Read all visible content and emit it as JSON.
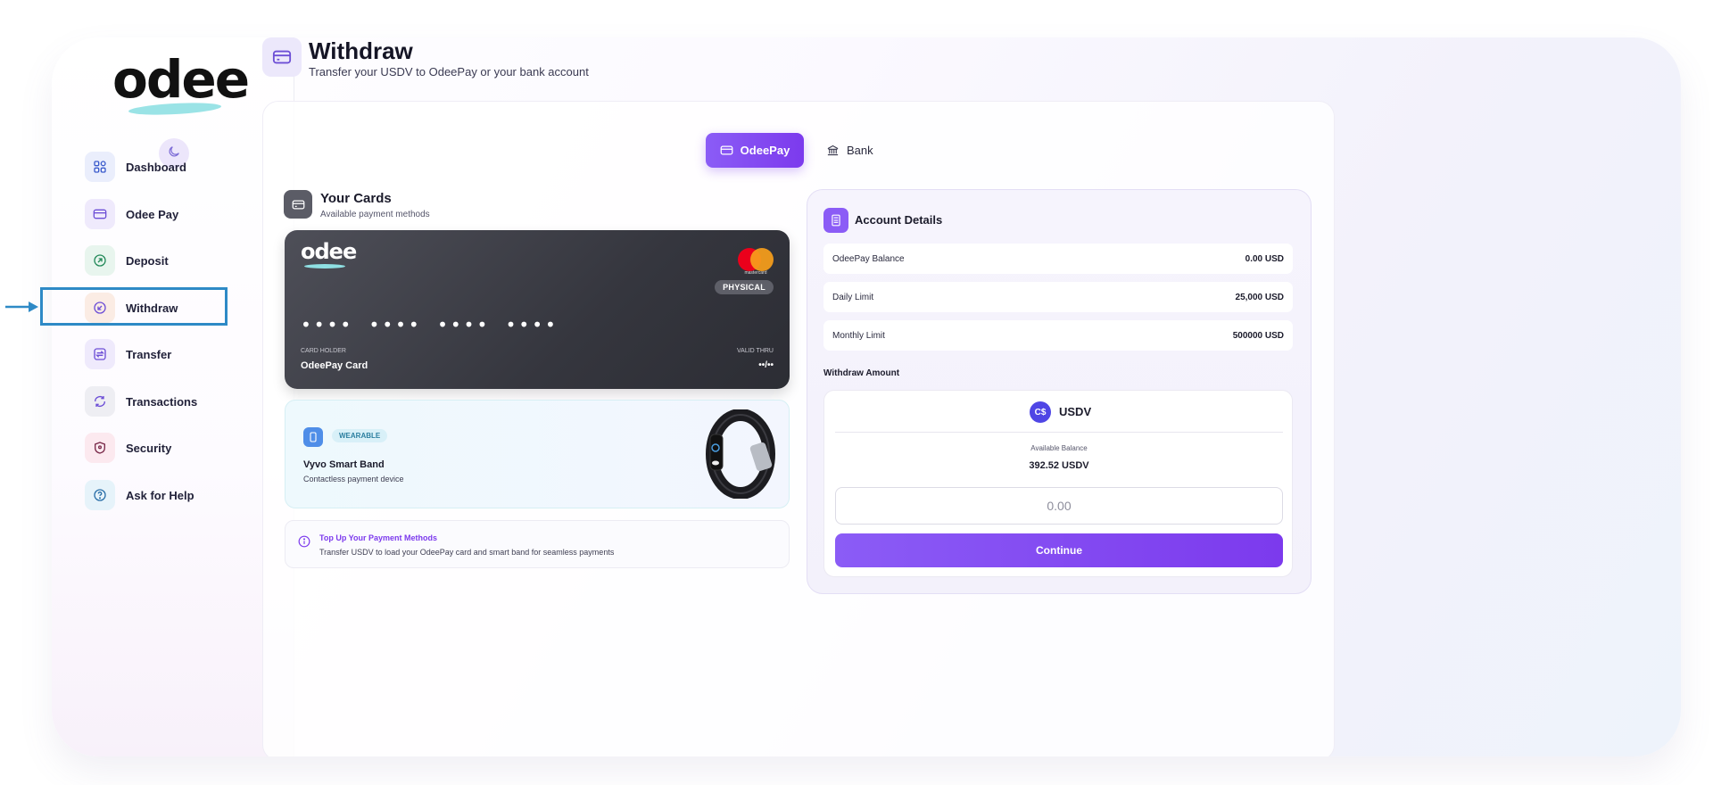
{
  "brand": {
    "logo_text": "odee"
  },
  "sidebar": {
    "items": [
      {
        "label": "Dashboard",
        "icon": "dashboard-grid-icon"
      },
      {
        "label": "Odee Pay",
        "icon": "card-icon"
      },
      {
        "label": "Deposit",
        "icon": "deposit-icon"
      },
      {
        "label": "Withdraw",
        "icon": "withdraw-icon"
      },
      {
        "label": "Transfer",
        "icon": "transfer-icon"
      },
      {
        "label": "Transactions",
        "icon": "refresh-icon"
      },
      {
        "label": "Security",
        "icon": "shield-icon"
      },
      {
        "label": "Ask for Help",
        "icon": "help-icon"
      }
    ],
    "active": "Withdraw"
  },
  "header": {
    "title": "Withdraw",
    "subtitle": "Transfer your USDV to OdeePay or your bank account"
  },
  "tabs": {
    "oddeepay": "OdeePay",
    "bank": "Bank",
    "selected": "OdeePay"
  },
  "cards": {
    "title": "Your Cards",
    "subtitle": "Available payment methods",
    "card": {
      "logo": "odee",
      "network": "mastercard",
      "type_badge": "PHYSICAL",
      "number": "•••• •••• •••• ••••",
      "holder_label": "CARD HOLDER",
      "holder": "OdeePay Card",
      "valid_label": "VALID THRU",
      "valid": "••/••"
    },
    "wearable": {
      "badge": "WEARABLE",
      "title": "Vyvo Smart Band",
      "subtitle": "Contactless payment device"
    },
    "info": {
      "title": "Top Up Your Payment Methods",
      "text": "Transfer USDV to load your OdeePay card and smart band for seamless payments"
    }
  },
  "account": {
    "title": "Account Details",
    "rows": [
      {
        "label": "OdeePay Balance",
        "value": "0.00 USD"
      },
      {
        "label": "Daily Limit",
        "value": "25,000 USD"
      },
      {
        "label": "Monthly Limit",
        "value": "500000 USD"
      }
    ],
    "withdraw_label": "Withdraw Amount",
    "currency": "USDV",
    "available_label": "Available Balance",
    "available_value": "392.52 USDV",
    "amount_placeholder": "0.00",
    "continue_label": "Continue"
  },
  "colors": {
    "accent": "#7c3aed",
    "annotation": "#2e8ac6"
  }
}
